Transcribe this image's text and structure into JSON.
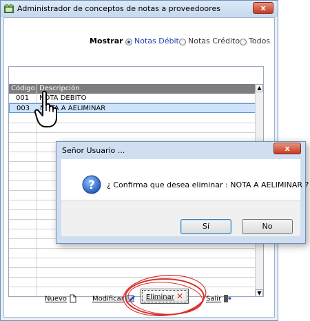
{
  "window": {
    "title": "Administrador de conceptos de notas a proveedoores",
    "close_label": "x"
  },
  "filter": {
    "label": "Mostrar",
    "options": [
      {
        "label": "Notas Débito",
        "selected": true
      },
      {
        "label": "Notas Crédito",
        "selected": false
      },
      {
        "label": "Todos",
        "selected": false
      }
    ]
  },
  "grid": {
    "columns": [
      "Código",
      "Descripción"
    ],
    "rows": [
      {
        "code": "001",
        "desc": "NOTA DEBITO"
      },
      {
        "code": "003",
        "desc": "NOTA A AELIMINAR"
      }
    ]
  },
  "toolbar": {
    "nuevo": "Nuevo",
    "modificar": "Modificar",
    "eliminar": "Eliminar",
    "salir": "Salir"
  },
  "dialog": {
    "title": "Señor Usuario ...",
    "message": "¿ Confirma que desea eliminar : NOTA A AELIMINAR ?",
    "yes_label": "Sí",
    "no_label": "No"
  },
  "colors": {
    "selection": "#cde4fb",
    "header": "#7d7d80",
    "highlight_ring": "#d8302c",
    "close_button": "#c43c22"
  }
}
